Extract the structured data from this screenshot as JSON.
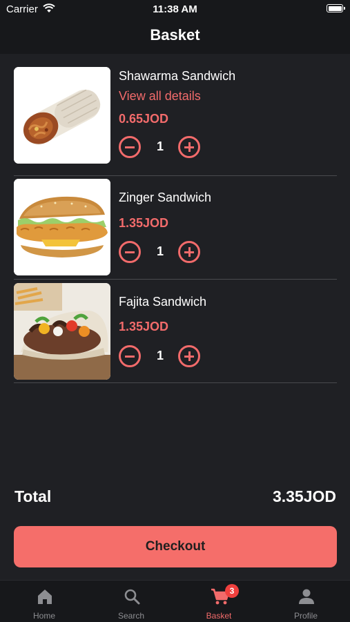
{
  "status_bar": {
    "carrier": "Carrier",
    "time": "11:38 AM"
  },
  "header": {
    "title": "Basket"
  },
  "basket": {
    "items": [
      {
        "name": "Shawarma Sandwich",
        "details_link": "View all details",
        "price": "0.65JOD",
        "quantity": "1"
      },
      {
        "name": "Zinger Sandwich",
        "price": "1.35JOD",
        "quantity": "1"
      },
      {
        "name": "Fajita Sandwich",
        "price": "1.35JOD",
        "quantity": "1"
      }
    ]
  },
  "summary": {
    "total_label": "Total",
    "total_value": "3.35JOD",
    "checkout_label": "Checkout"
  },
  "tabbar": {
    "items": [
      {
        "label": "Home",
        "icon": "home-icon"
      },
      {
        "label": "Search",
        "icon": "search-icon"
      },
      {
        "label": "Basket",
        "icon": "cart-icon",
        "badge": "3",
        "active": true
      },
      {
        "label": "Profile",
        "icon": "person-icon"
      }
    ]
  },
  "colors": {
    "accent": "#f26b6b",
    "background": "#1f2024",
    "bar": "#17181b",
    "badge": "#f0403e"
  }
}
